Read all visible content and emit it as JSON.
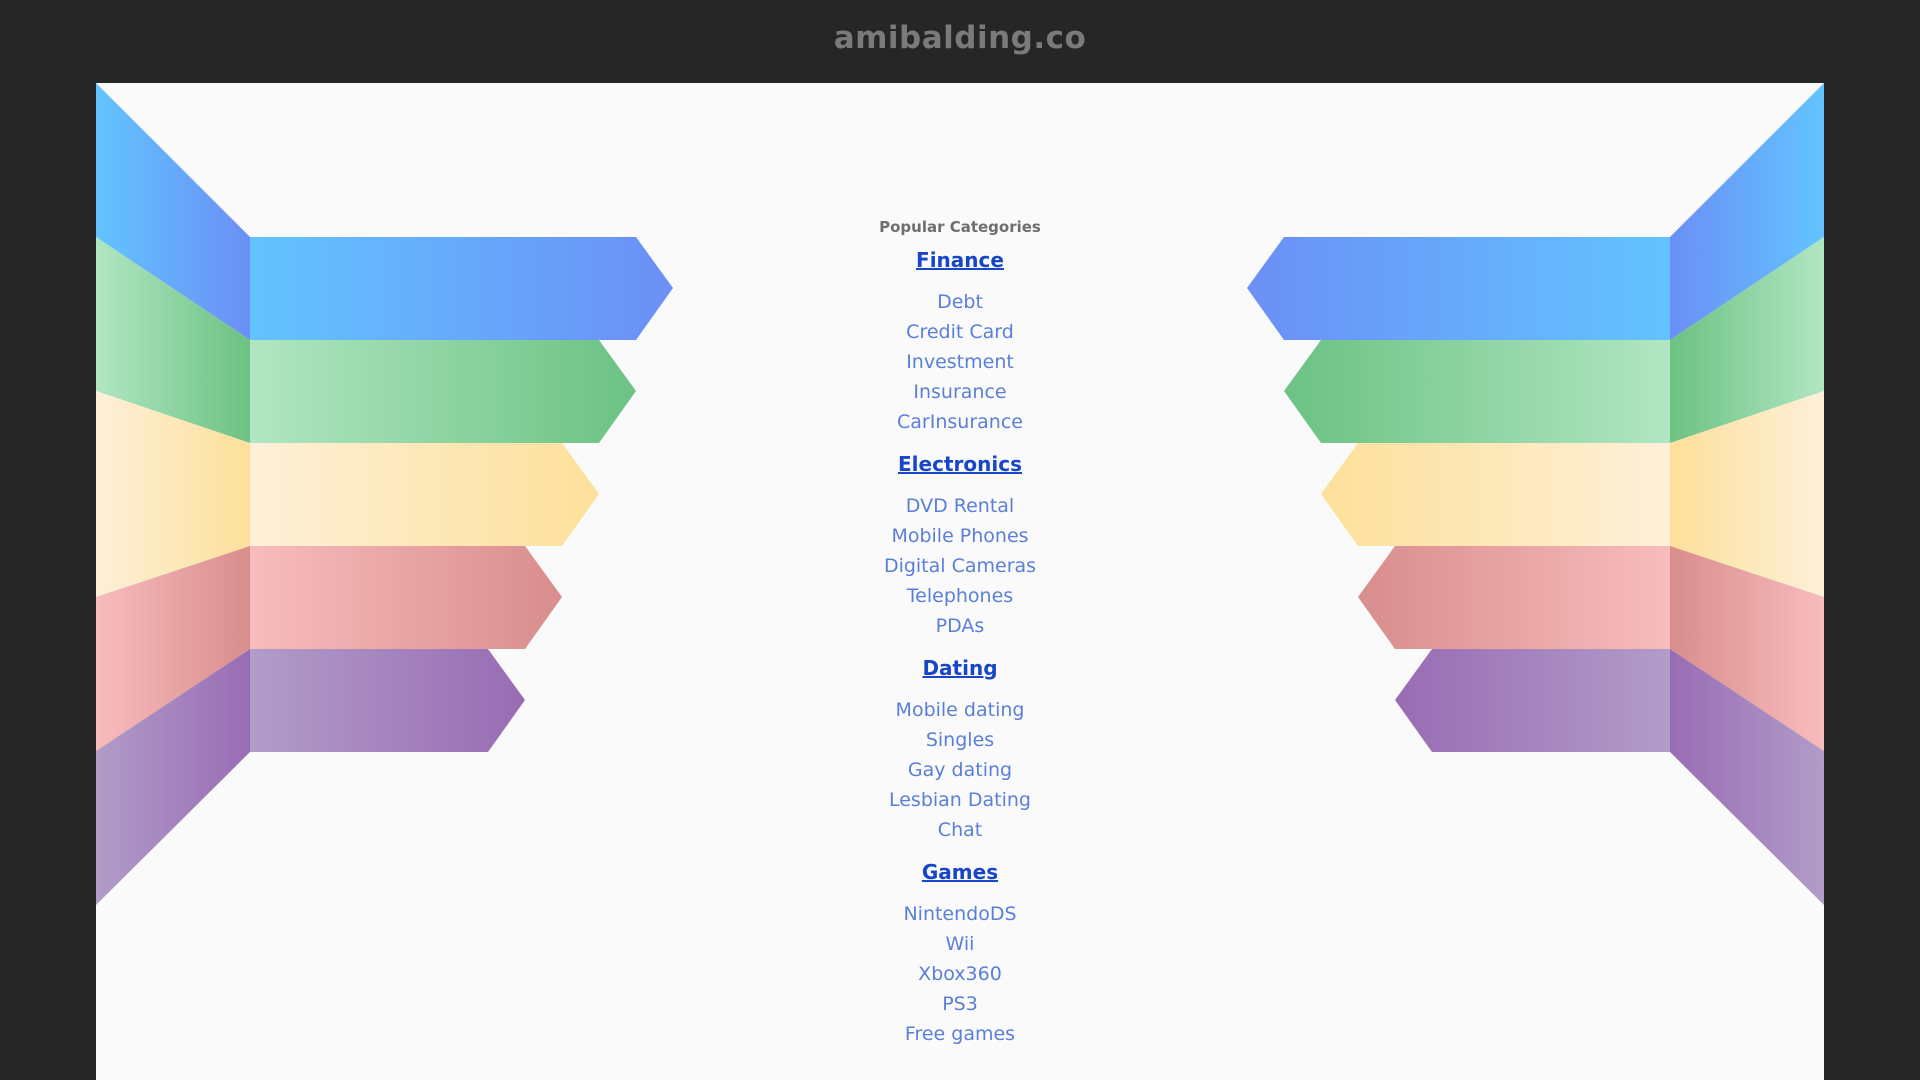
{
  "header": {
    "domain": "amibalding.co"
  },
  "main": {
    "heading": "Popular Categories",
    "categories": [
      {
        "title": "Finance",
        "links": [
          "Debt",
          "Credit Card",
          "Investment",
          "Insurance",
          "CarInsurance"
        ]
      },
      {
        "title": "Electronics",
        "links": [
          "DVD Rental",
          "Mobile Phones",
          "Digital Cameras",
          "Telephones",
          "PDAs"
        ]
      },
      {
        "title": "Dating",
        "links": [
          "Mobile dating",
          "Singles",
          "Gay dating",
          "Lesbian Dating",
          "Chat"
        ]
      },
      {
        "title": "Games",
        "links": [
          "NintendoDS",
          "Wii",
          "Xbox360",
          "PS3",
          "Free games"
        ]
      }
    ]
  },
  "colors": {
    "page_background": "#262626",
    "content_background": "#fafafa",
    "category_title": "#1746c9",
    "category_link": "#5a7fd8",
    "ribbon_blue": "#64c3ff",
    "ribbon_green": "#6fc386",
    "ribbon_yellow": "#fde29e",
    "ribbon_red": "#df9694",
    "ribbon_purple": "#9a6fb6"
  }
}
